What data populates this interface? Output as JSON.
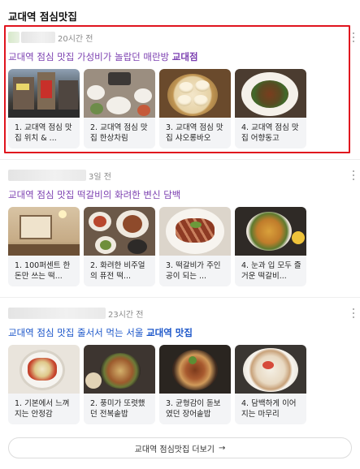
{
  "section_title": "교대역 점심맛집",
  "results": [
    {
      "timestamp": "20시간 전",
      "title_pre": "교대역 점심 맛집 가성비가 놀랍던 매란방 ",
      "title_highlight": "교대점",
      "title_color": "#7b3fb0",
      "cards": [
        {
          "caption": "1. 교대역 점심 맛집 위치 & ...",
          "thumb": "street"
        },
        {
          "caption": "2. 교대역 점심 맛집 한상차림",
          "thumb": "table"
        },
        {
          "caption": "3. 교대역 점심 맛집 샤오롱바오",
          "thumb": "dumpling"
        },
        {
          "caption": "4. 교대역 점심 맛집 어향동고",
          "thumb": "stirfry"
        }
      ]
    },
    {
      "timestamp": "3일 전",
      "title_pre": "교대역 점심 맛집 떡갈비의 화려한 변신 담백",
      "title_highlight": "",
      "title_color": "#7b3fb0",
      "cards": [
        {
          "caption": "1. 100퍼센트 한돈만 쓰는 떡...",
          "thumb": "interior"
        },
        {
          "caption": "2. 화려한 비주얼의 퓨전 떡...",
          "thumb": "spread"
        },
        {
          "caption": "3. 떡갈비가 주인공이 되는 ...",
          "thumb": "meat"
        },
        {
          "caption": "4. 눈과 입 모두 즐거운 떡갈비...",
          "thumb": "bowl"
        }
      ]
    },
    {
      "timestamp": "23시간 전",
      "title_pre": "교대역 점심 맛집 줄서서 먹는 서울 ",
      "title_highlight": "교대역 맛집",
      "title_color": "#1a55c9",
      "cards": [
        {
          "caption": "1. 기본에서 느껴지는 안정감",
          "thumb": "kimchi"
        },
        {
          "caption": "2. 풍미가 또렷했던 전복솥밥",
          "thumb": "rice"
        },
        {
          "caption": "3. 균형감이 돋보였던 장어솥밥",
          "thumb": "eel"
        },
        {
          "caption": "4. 담백하게 이어지는 마무리",
          "thumb": "soup"
        }
      ]
    }
  ],
  "more_link": {
    "label": "교대역 점심맛집 더보기",
    "arrow": "→"
  },
  "colors": {
    "highlight_border": "#e0141e",
    "visited_title": "#7b3fb0",
    "link_title": "#1a55c9"
  }
}
